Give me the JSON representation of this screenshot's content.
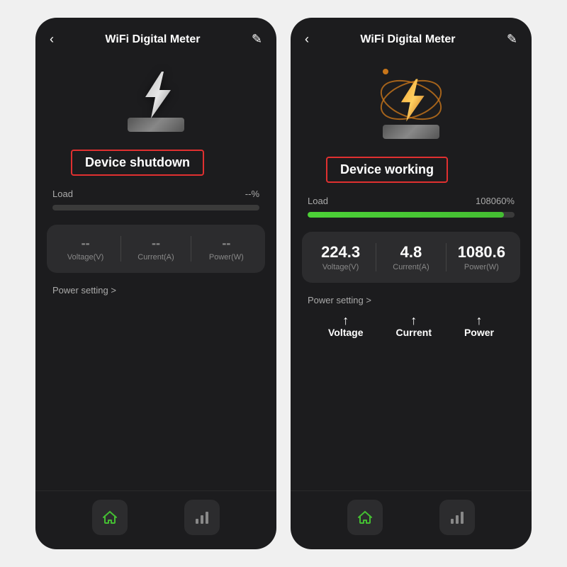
{
  "left_card": {
    "header": {
      "back_label": "‹",
      "title": "WiFi Digital Meter",
      "edit_icon": "✎"
    },
    "status": "Device shutdown",
    "load": {
      "label": "Load",
      "value": "--%",
      "progress": 0
    },
    "metrics": {
      "voltage": {
        "value": "--",
        "label": "Voltage(V)"
      },
      "current": {
        "value": "--",
        "label": "Current(A)"
      },
      "power": {
        "value": "--",
        "label": "Power(W)"
      }
    },
    "power_setting": "Power setting >"
  },
  "right_card": {
    "header": {
      "back_label": "‹",
      "title": "WiFi Digital Meter",
      "edit_icon": "✎"
    },
    "status": "Device working",
    "load": {
      "label": "Load",
      "value": "108060%",
      "progress": 95
    },
    "metrics": {
      "voltage": {
        "value": "224.3",
        "label": "Voltage(V)"
      },
      "current": {
        "value": "4.8",
        "label": "Current(A)"
      },
      "power": {
        "value": "1080.6",
        "label": "Power(W)"
      }
    },
    "power_setting": "Power setting >",
    "annotations": {
      "voltage_label": "Voltage",
      "current_label": "Current",
      "power_label": "Power"
    }
  },
  "nav": {
    "home_label": "home",
    "chart_label": "chart"
  },
  "colors": {
    "status_border": "#e03030",
    "progress_active": "#44bd32",
    "background": "#1c1c1e",
    "card_bg": "#2c2c2e"
  }
}
